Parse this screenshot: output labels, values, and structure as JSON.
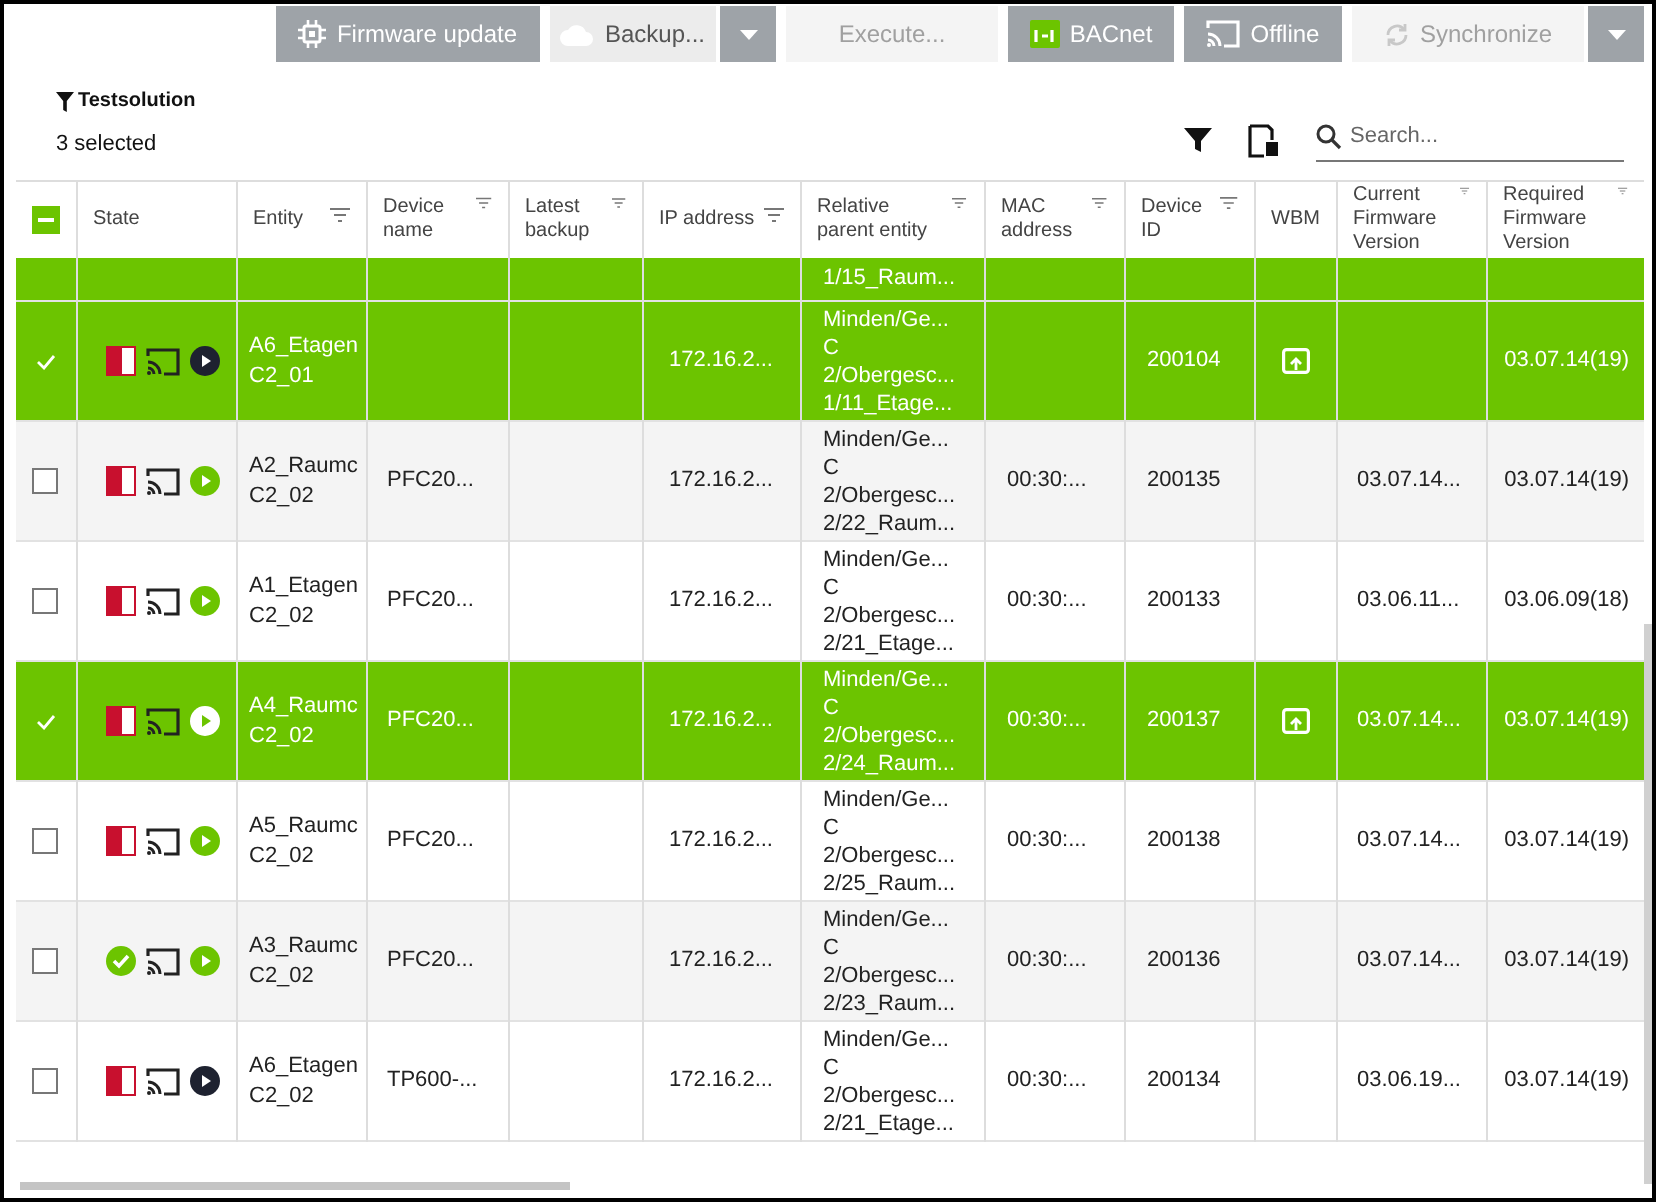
{
  "toolbar": [
    {
      "label": "Firmware update",
      "kind": "primary"
    },
    {
      "label": "Backup...",
      "kind": "light",
      "dropdown": true
    },
    {
      "label": "Execute...",
      "kind": "disabled"
    },
    {
      "label": "BACnet",
      "kind": "primary"
    },
    {
      "label": "Offline",
      "kind": "primary"
    },
    {
      "label": "Synchronize",
      "kind": "disabled",
      "dropdown": true
    }
  ],
  "filter_title": "Testsolution",
  "selection_count": "3 selected",
  "search": {
    "placeholder": "Search..."
  },
  "table": {
    "select_all": {
      "indeterminate": true
    },
    "columns": [
      "State",
      "Entity",
      "Device name",
      "Latest backup",
      "IP address",
      "Relative parent entity",
      "MAC address",
      "Device ID",
      "WBM",
      "Current Firmware Version",
      "Required Firmware Version"
    ],
    "filterable": [
      false,
      true,
      true,
      true,
      true,
      true,
      true,
      true,
      false,
      true,
      true
    ],
    "rows": [
      {
        "kind": "partial",
        "selected": true,
        "relative_parent": [
          "1/15_Raum..."
        ]
      },
      {
        "kind": "full",
        "selected": true,
        "ok": false,
        "running": false,
        "entity": [
          "A6_Etagen",
          "C2_01"
        ],
        "ip": "172.16.2...",
        "relative_parent": [
          "Minden/Ge...",
          "C",
          "2/Obergesc...",
          "1/11_Etage..."
        ],
        "device_id": "200104",
        "wbm": true,
        "required_fw": "03.07.14(19)"
      },
      {
        "kind": "full",
        "selected": false,
        "ok": false,
        "running": true,
        "entity": [
          "A2_Raumc",
          "C2_02"
        ],
        "device_name": "PFC20...",
        "ip": "172.16.2...",
        "relative_parent": [
          "Minden/Ge...",
          "C",
          "2/Obergesc...",
          "2/22_Raum..."
        ],
        "mac": "00:30:...",
        "device_id": "200135",
        "wbm": false,
        "current_fw": "03.07.14...",
        "required_fw": "03.07.14(19)"
      },
      {
        "kind": "full",
        "selected": false,
        "ok": false,
        "running": true,
        "entity": [
          "A1_Etagen",
          "C2_02"
        ],
        "device_name": "PFC20...",
        "ip": "172.16.2...",
        "relative_parent": [
          "Minden/Ge...",
          "C",
          "2/Obergesc...",
          "2/21_Etage..."
        ],
        "mac": "00:30:...",
        "device_id": "200133",
        "wbm": false,
        "current_fw": "03.06.11...",
        "required_fw": "03.06.09(18)"
      },
      {
        "kind": "full",
        "selected": true,
        "ok": false,
        "running": true,
        "entity": [
          "A4_Raumc",
          "C2_02"
        ],
        "device_name": "PFC20...",
        "ip": "172.16.2...",
        "relative_parent": [
          "Minden/Ge...",
          "C",
          "2/Obergesc...",
          "2/24_Raum..."
        ],
        "mac": "00:30:...",
        "device_id": "200137",
        "wbm": true,
        "current_fw": "03.07.14...",
        "required_fw": "03.07.14(19)"
      },
      {
        "kind": "full",
        "selected": false,
        "ok": false,
        "running": true,
        "entity": [
          "A5_Raumc",
          "C2_02"
        ],
        "device_name": "PFC20...",
        "ip": "172.16.2...",
        "relative_parent": [
          "Minden/Ge...",
          "C",
          "2/Obergesc...",
          "2/25_Raum..."
        ],
        "mac": "00:30:...",
        "device_id": "200138",
        "wbm": false,
        "current_fw": "03.07.14...",
        "required_fw": "03.07.14(19)"
      },
      {
        "kind": "full",
        "selected": false,
        "ok": true,
        "running": true,
        "entity": [
          "A3_Raumc",
          "C2_02"
        ],
        "device_name": "PFC20...",
        "ip": "172.16.2...",
        "relative_parent": [
          "Minden/Ge...",
          "C",
          "2/Obergesc...",
          "2/23_Raum..."
        ],
        "mac": "00:30:...",
        "device_id": "200136",
        "wbm": false,
        "current_fw": "03.07.14...",
        "required_fw": "03.07.14(19)"
      },
      {
        "kind": "full",
        "selected": false,
        "ok": false,
        "running": false,
        "entity": [
          "A6_Etagen",
          "C2_02"
        ],
        "device_name": "TP600-...",
        "ip": "172.16.2...",
        "relative_parent": [
          "Minden/Ge...",
          "C",
          "2/Obergesc...",
          "2/21_Etage..."
        ],
        "mac": "00:30:...",
        "device_id": "200134",
        "wbm": false,
        "current_fw": "03.06.19...",
        "required_fw": "03.07.14(19)"
      }
    ]
  }
}
